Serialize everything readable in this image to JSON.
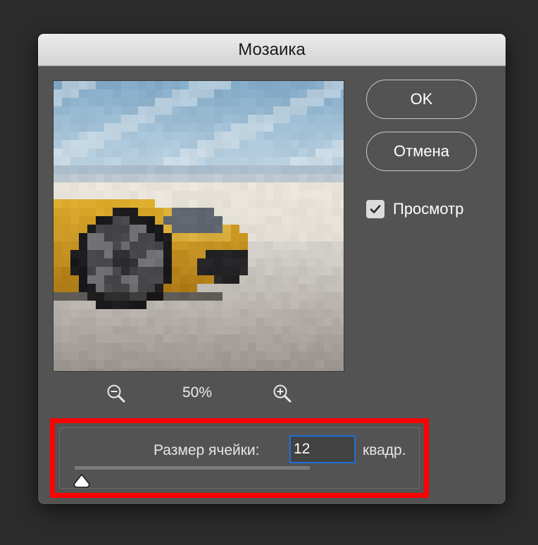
{
  "dialog": {
    "title": "Мозаика"
  },
  "buttons": {
    "ok_label": "OK",
    "cancel_label": "Отмена"
  },
  "preview_checkbox": {
    "label": "Просмотр",
    "checked": true
  },
  "zoom": {
    "zoom_out_icon": "zoom-out-icon",
    "zoom_in_icon": "zoom-in-icon",
    "value": "50%"
  },
  "cell_size": {
    "label": "Размер ячейки:",
    "value": "12",
    "unit": "квадр.",
    "slider_fraction": 0.03
  },
  "colors": {
    "dialog_bg": "#535353",
    "highlight": "#ff0000",
    "input_focus": "#1f6fd6",
    "car": "#d4a326"
  }
}
